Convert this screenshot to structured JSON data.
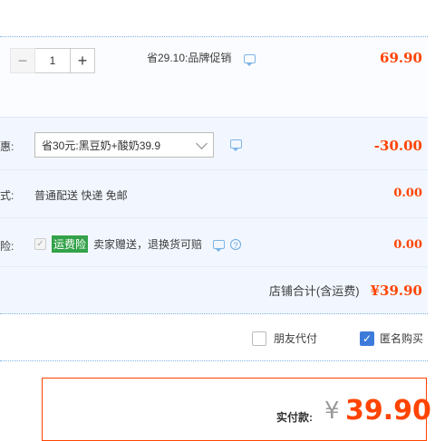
{
  "item": {
    "quantity": "1",
    "minus_symbol": "−",
    "plus_symbol": "+",
    "promo_text": "省29.10:品牌促销",
    "price": "69.90"
  },
  "coupon": {
    "label": "惠:",
    "selected": "省30元:黑豆奶+酸奶39.9",
    "amount": "-30.00"
  },
  "shipping": {
    "label": "式:",
    "method": "普通配送 快递 免邮",
    "amount": "0.00"
  },
  "insurance": {
    "label": "险:",
    "badge": "运费险",
    "desc": "卖家赠送，退换货可赔",
    "amount": "0.00"
  },
  "shop_total": {
    "label": "店铺合计(含运费)",
    "amount": "¥39.90"
  },
  "options": {
    "friend_pay": "朋友代付",
    "anonymous": "匿名购买"
  },
  "payment": {
    "label": "实付款:",
    "currency": "¥",
    "amount": "39.90"
  },
  "colors": {
    "price_red": "#ff4400",
    "border_blue": "#80b2e6",
    "badge_green": "#34a24a",
    "checkbox_blue": "#3d7bdb"
  }
}
